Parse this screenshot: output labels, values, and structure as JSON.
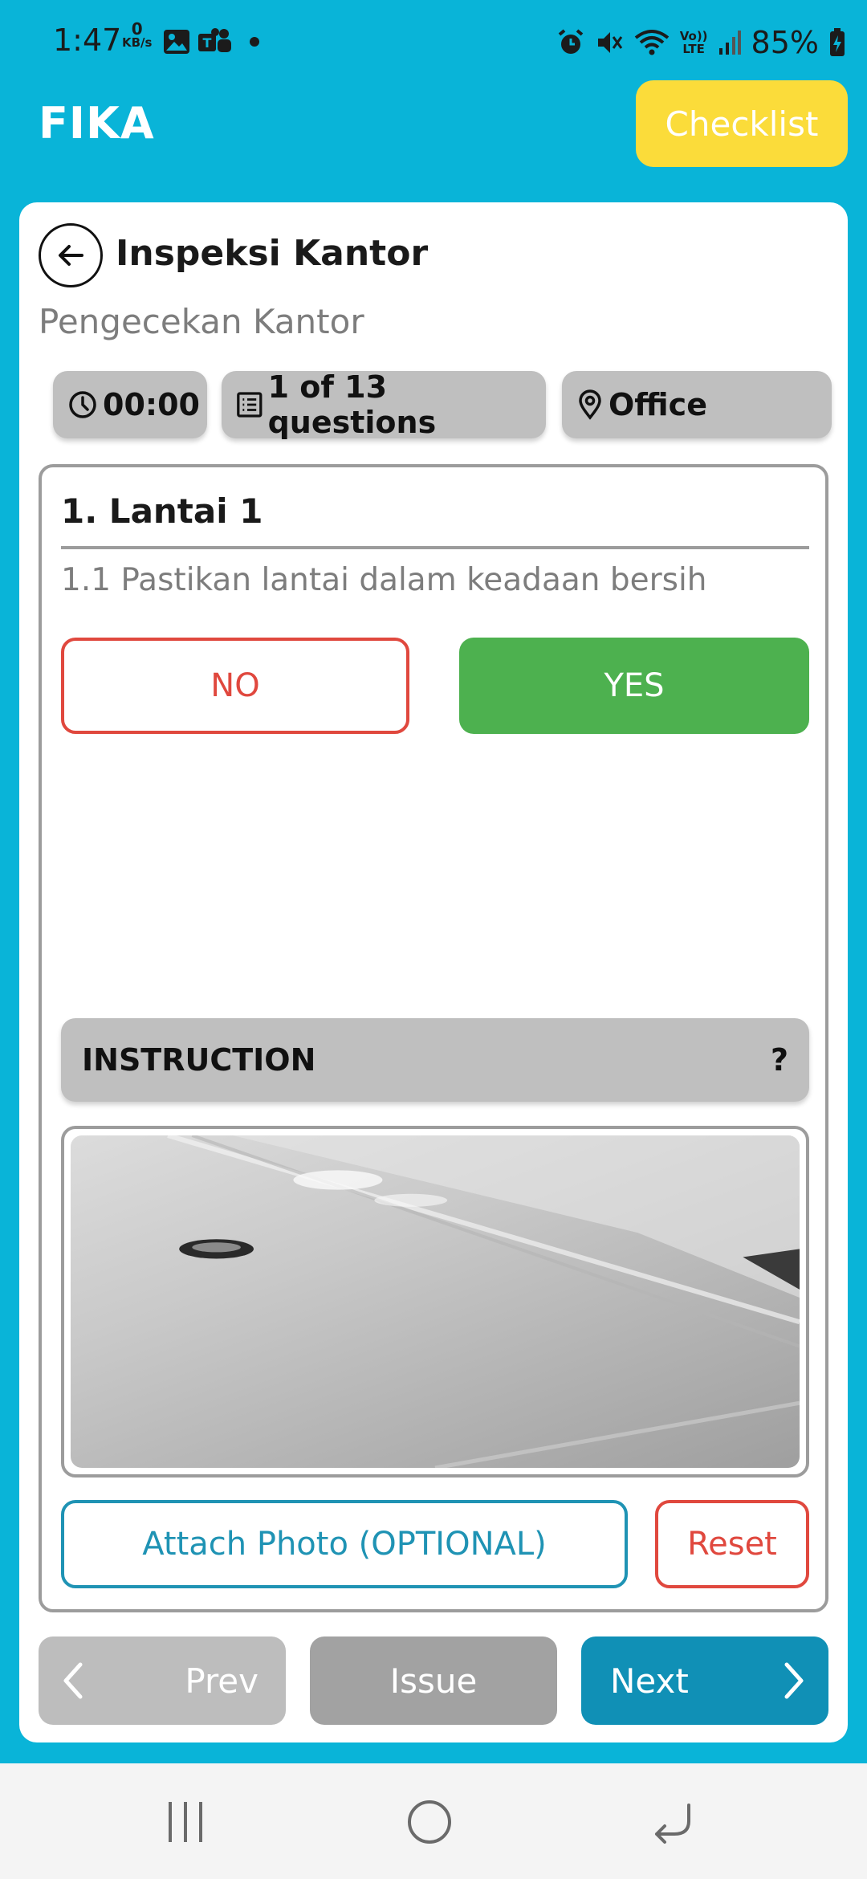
{
  "status_bar": {
    "time": "1:47",
    "net_speed_value": "0",
    "net_speed_unit": "KB/s",
    "battery": "85%",
    "lte_top": "Vo))",
    "lte_bottom": "LTE"
  },
  "header": {
    "app_title": "FIKA",
    "checklist_label": "Checklist"
  },
  "inspection": {
    "title": "Inspeksi Kantor",
    "subtitle": "Pengecekan Kantor",
    "timer": "00:00",
    "progress": "1 of 13 questions",
    "location": "Office"
  },
  "question": {
    "section_title": "1. Lantai 1",
    "text": "1.1 Pastikan lantai dalam keadaan bersih",
    "no_label": "NO",
    "yes_label": "YES",
    "selected_answer": "YES"
  },
  "instruction": {
    "label": "INSTRUCTION",
    "help_symbol": "?"
  },
  "actions": {
    "attach_label": "Attach Photo (OPTIONAL)",
    "reset_label": "Reset"
  },
  "navigation": {
    "prev_label": "Prev",
    "issue_label": "Issue",
    "next_label": "Next"
  },
  "colors": {
    "background": "#09b4d8",
    "checklist_button": "#fbdc3a",
    "yes_button": "#4db14f",
    "no_button": "#e0483e",
    "next_button": "#1090b6",
    "attach_button": "#1f93b4"
  },
  "icons": [
    "back-arrow-icon",
    "clock-icon",
    "list-icon",
    "location-pin-icon",
    "chevron-left-icon",
    "chevron-right-icon",
    "recent-apps-icon",
    "home-icon",
    "back-icon"
  ]
}
